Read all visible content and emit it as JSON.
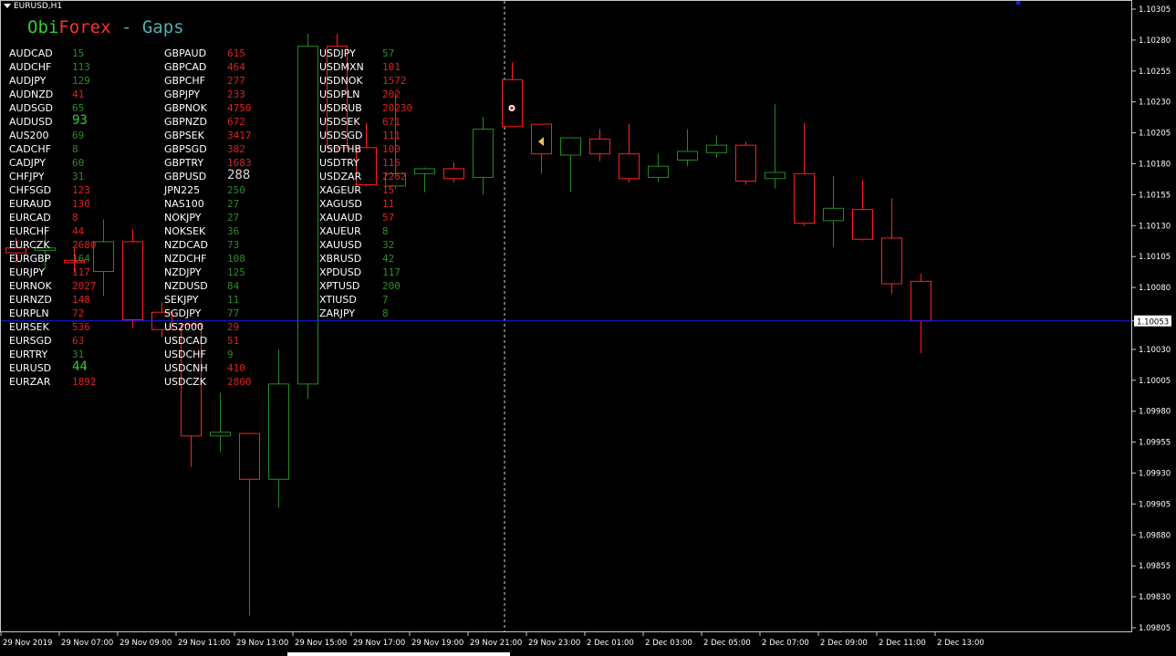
{
  "window": {
    "symbol": "EURUSD,H1"
  },
  "indicator_title": {
    "part1": "Obi",
    "part2": "Forex",
    "part3": " - Gaps"
  },
  "colors": {
    "background": "#000000",
    "bull": "#228b22",
    "bear": "#ff2020",
    "bid_line": "#1a1aff",
    "gap_up": "#2e8b2e",
    "gap_down": "#e02020",
    "gap_neutral": "#d8d8d8",
    "title_green": "#32cd32",
    "title_red": "#ff3030",
    "title_teal": "#4fb0b0"
  },
  "gaps": {
    "col1": [
      {
        "symbol": "AUDCAD",
        "value": "15",
        "color": "up"
      },
      {
        "symbol": "AUDCHF",
        "value": "113",
        "color": "up"
      },
      {
        "symbol": "AUDJPY",
        "value": "129",
        "color": "up"
      },
      {
        "symbol": "AUDNZD",
        "value": "41",
        "color": "dn"
      },
      {
        "symbol": "AUDSGD",
        "value": "65",
        "color": "up"
      },
      {
        "symbol": "AUDUSD",
        "value": "93",
        "color": "gbright",
        "big": true
      },
      {
        "symbol": "AUS200",
        "value": "69",
        "color": "up"
      },
      {
        "symbol": "CADCHF",
        "value": "8",
        "color": "up"
      },
      {
        "symbol": "CADJPY",
        "value": "60",
        "color": "up"
      },
      {
        "symbol": "CHFJPY",
        "value": "31",
        "color": "up"
      },
      {
        "symbol": "CHFSGD",
        "value": "123",
        "color": "dn"
      },
      {
        "symbol": "EURAUD",
        "value": "130",
        "color": "dn"
      },
      {
        "symbol": "EURCAD",
        "value": "8",
        "color": "dn"
      },
      {
        "symbol": "EURCHF",
        "value": "44",
        "color": "dn"
      },
      {
        "symbol": "EURCZK",
        "value": "2680",
        "color": "dn"
      },
      {
        "symbol": "EURGBP",
        "value": "164",
        "color": "up"
      },
      {
        "symbol": "EURJPY",
        "value": "117",
        "color": "dn"
      },
      {
        "symbol": "EURNOK",
        "value": "2027",
        "color": "dn"
      },
      {
        "symbol": "EURNZD",
        "value": "148",
        "color": "dn"
      },
      {
        "symbol": "EURPLN",
        "value": "72",
        "color": "dn"
      },
      {
        "symbol": "EURSEK",
        "value": "536",
        "color": "dn"
      },
      {
        "symbol": "EURSGD",
        "value": "63",
        "color": "dn"
      },
      {
        "symbol": "EURTRY",
        "value": "31",
        "color": "up"
      },
      {
        "symbol": "EURUSD",
        "value": "44",
        "color": "gbright",
        "big": true
      },
      {
        "symbol": "EURZAR",
        "value": "1892",
        "color": "dn"
      }
    ],
    "col2": [
      {
        "symbol": "GBPAUD",
        "value": "615",
        "color": "dn"
      },
      {
        "symbol": "GBPCAD",
        "value": "464",
        "color": "dn"
      },
      {
        "symbol": "GBPCHF",
        "value": "277",
        "color": "dn"
      },
      {
        "symbol": "GBPJPY",
        "value": "233",
        "color": "dn"
      },
      {
        "symbol": "GBPNOK",
        "value": "4750",
        "color": "dn"
      },
      {
        "symbol": "GBPNZD",
        "value": "672",
        "color": "dn"
      },
      {
        "symbol": "GBPSEK",
        "value": "3417",
        "color": "dn"
      },
      {
        "symbol": "GBPSGD",
        "value": "382",
        "color": "dn"
      },
      {
        "symbol": "GBPTRY",
        "value": "1683",
        "color": "dn"
      },
      {
        "symbol": "GBPUSD",
        "value": "288",
        "color": "neu",
        "big": true
      },
      {
        "symbol": "JPN225",
        "value": "250",
        "color": "up"
      },
      {
        "symbol": "NAS100",
        "value": "27",
        "color": "up"
      },
      {
        "symbol": "NOKJPY",
        "value": "27",
        "color": "up"
      },
      {
        "symbol": "NOKSEK",
        "value": "36",
        "color": "up"
      },
      {
        "symbol": "NZDCAD",
        "value": "73",
        "color": "up"
      },
      {
        "symbol": "NZDCHF",
        "value": "108",
        "color": "up"
      },
      {
        "symbol": "NZDJPY",
        "value": "125",
        "color": "up"
      },
      {
        "symbol": "NZDUSD",
        "value": "84",
        "color": "up"
      },
      {
        "symbol": "SEKJPY",
        "value": "11",
        "color": "up"
      },
      {
        "symbol": "SGDJPY",
        "value": "77",
        "color": "up"
      },
      {
        "symbol": "US2000",
        "value": "29",
        "color": "dn"
      },
      {
        "symbol": "USDCAD",
        "value": "51",
        "color": "dn"
      },
      {
        "symbol": "USDCHF",
        "value": "9",
        "color": "up"
      },
      {
        "symbol": "USDCNH",
        "value": "410",
        "color": "dn"
      },
      {
        "symbol": "USDCZK",
        "value": "2800",
        "color": "dn"
      }
    ],
    "col3": [
      {
        "symbol": "USDJPY",
        "value": "57",
        "color": "up"
      },
      {
        "symbol": "USDMXN",
        "value": "101",
        "color": "dn"
      },
      {
        "symbol": "USDNOK",
        "value": "1572",
        "color": "dn"
      },
      {
        "symbol": "USDPLN",
        "value": "202",
        "color": "dn"
      },
      {
        "symbol": "USDRUB",
        "value": "20230",
        "color": "dn"
      },
      {
        "symbol": "USDSEK",
        "value": "671",
        "color": "dn"
      },
      {
        "symbol": "USDSGD",
        "value": "111",
        "color": "dn"
      },
      {
        "symbol": "USDTHB",
        "value": "100",
        "color": "dn"
      },
      {
        "symbol": "USDTRY",
        "value": "116",
        "color": "dn"
      },
      {
        "symbol": "USDZAR",
        "value": "2262",
        "color": "dn"
      },
      {
        "symbol": "XAGEUR",
        "value": "15",
        "color": "dn"
      },
      {
        "symbol": "XAGUSD",
        "value": "11",
        "color": "dn"
      },
      {
        "symbol": "XAUAUD",
        "value": "57",
        "color": "dn"
      },
      {
        "symbol": "XAUEUR",
        "value": "8",
        "color": "up"
      },
      {
        "symbol": "XAUUSD",
        "value": "32",
        "color": "up"
      },
      {
        "symbol": "XBRUSD",
        "value": "42",
        "color": "up"
      },
      {
        "symbol": "XPDUSD",
        "value": "117",
        "color": "up"
      },
      {
        "symbol": "XPTUSD",
        "value": "200",
        "color": "up"
      },
      {
        "symbol": "XTIUSD",
        "value": "7",
        "color": "up"
      },
      {
        "symbol": "ZARJPY",
        "value": "8",
        "color": "up"
      }
    ]
  },
  "chart_data": {
    "type": "candlestick",
    "title": "EURUSD,H1",
    "ylim": [
      1.09805,
      1.10305
    ],
    "y_ticks": [
      "1.10305",
      "1.10280",
      "1.10255",
      "1.10230",
      "1.10205",
      "1.10180",
      "1.10155",
      "1.10130",
      "1.10105",
      "1.10080",
      "1.10053",
      "1.10030",
      "1.10005",
      "1.09980",
      "1.09955",
      "1.09930",
      "1.09905",
      "1.09880",
      "1.09855",
      "1.09830",
      "1.09805"
    ],
    "current_price": "1.10053",
    "x_ticks": [
      "29 Nov 2019",
      "29 Nov 07:00",
      "29 Nov 09:00",
      "29 Nov 11:00",
      "29 Nov 13:00",
      "29 Nov 15:00",
      "29 Nov 17:00",
      "29 Nov 19:00",
      "29 Nov 21:00",
      "29 Nov 23:00",
      "2 Dec 01:00",
      "2 Dec 03:00",
      "2 Dec 05:00",
      "2 Dec 07:00",
      "2 Dec 09:00",
      "2 Dec 11:00",
      "2 Dec 13:00"
    ],
    "candles": [
      {
        "o": 1.10112,
        "h": 1.1012,
        "l": 1.101,
        "c": 1.10108
      },
      {
        "o": 1.1011,
        "h": 1.1013,
        "l": 1.10095,
        "c": 1.10112
      },
      {
        "o": 1.10102,
        "h": 1.10112,
        "l": 1.10092,
        "c": 1.101
      },
      {
        "o": 1.10093,
        "h": 1.10135,
        "l": 1.10073,
        "c": 1.10117
      },
      {
        "o": 1.10117,
        "h": 1.10127,
        "l": 1.10047,
        "c": 1.10054
      },
      {
        "o": 1.1006,
        "h": 1.10068,
        "l": 1.1004,
        "c": 1.10046
      },
      {
        "o": 1.1005,
        "h": 1.1005,
        "l": 1.09935,
        "c": 1.0996
      },
      {
        "o": 1.0996,
        "h": 1.09995,
        "l": 1.09947,
        "c": 1.09963
      },
      {
        "o": 1.09962,
        "h": 1.09962,
        "l": 1.09815,
        "c": 1.09925
      },
      {
        "o": 1.09925,
        "h": 1.1003,
        "l": 1.09902,
        "c": 1.10002
      },
      {
        "o": 1.10002,
        "h": 1.10285,
        "l": 1.0999,
        "c": 1.10275
      },
      {
        "o": 1.10275,
        "h": 1.10285,
        "l": 1.1019,
        "c": 1.10193
      },
      {
        "o": 1.10193,
        "h": 1.10213,
        "l": 1.10162,
        "c": 1.10163
      },
      {
        "o": 1.10162,
        "h": 1.10237,
        "l": 1.1016,
        "c": 1.10172
      },
      {
        "o": 1.10172,
        "h": 1.10177,
        "l": 1.10157,
        "c": 1.10176
      },
      {
        "o": 1.10176,
        "h": 1.10181,
        "l": 1.10165,
        "c": 1.10168
      },
      {
        "o": 1.10169,
        "h": 1.10218,
        "l": 1.10155,
        "c": 1.10208
      },
      {
        "o": 1.10248,
        "h": 1.10262,
        "l": 1.1021,
        "c": 1.1021
      },
      {
        "o": 1.10212,
        "h": 1.10212,
        "l": 1.10172,
        "c": 1.10188
      },
      {
        "o": 1.10187,
        "h": 1.10201,
        "l": 1.10157,
        "c": 1.10201
      },
      {
        "o": 1.102,
        "h": 1.10208,
        "l": 1.10182,
        "c": 1.10188
      },
      {
        "o": 1.10188,
        "h": 1.10212,
        "l": 1.10165,
        "c": 1.10168
      },
      {
        "o": 1.10169,
        "h": 1.10188,
        "l": 1.10165,
        "c": 1.10178
      },
      {
        "o": 1.10183,
        "h": 1.10208,
        "l": 1.10178,
        "c": 1.1019
      },
      {
        "o": 1.10189,
        "h": 1.10203,
        "l": 1.10185,
        "c": 1.10195
      },
      {
        "o": 1.10195,
        "h": 1.10198,
        "l": 1.10163,
        "c": 1.10166
      },
      {
        "o": 1.10168,
        "h": 1.10228,
        "l": 1.1016,
        "c": 1.10173
      },
      {
        "o": 1.10172,
        "h": 1.10213,
        "l": 1.1013,
        "c": 1.10132
      },
      {
        "o": 1.10134,
        "h": 1.1017,
        "l": 1.10113,
        "c": 1.10144
      },
      {
        "o": 1.10143,
        "h": 1.10167,
        "l": 1.10118,
        "c": 1.10119
      },
      {
        "o": 1.1012,
        "h": 1.10152,
        "l": 1.10075,
        "c": 1.10083
      },
      {
        "o": 1.10085,
        "h": 1.10091,
        "l": 1.10027,
        "c": 1.10053
      }
    ],
    "markers": [
      {
        "candle": 17,
        "price": 1.10225,
        "kind": "white-diamond"
      },
      {
        "candle": 18,
        "price": 1.10198,
        "kind": "yellow-arrow-left"
      }
    ],
    "crosshair_candle": 17
  }
}
